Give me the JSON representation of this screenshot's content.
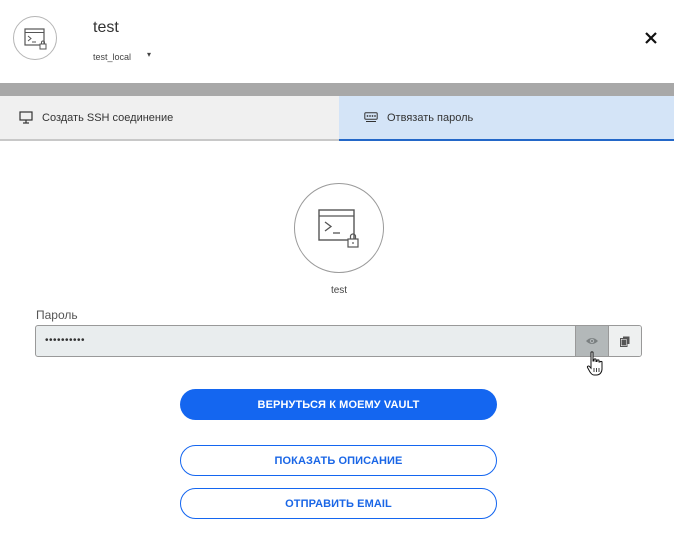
{
  "header": {
    "title": "test",
    "subtitle": "test_local",
    "caret": "▾",
    "close_icon": "close-icon"
  },
  "tabs": [
    {
      "label": "Создать SSH соединение",
      "icon": "monitor-icon",
      "active": false
    },
    {
      "label": "Отвязать пароль",
      "icon": "password-icon",
      "active": true
    }
  ],
  "vault_item": {
    "name": "test",
    "icon": "terminal-lock-icon"
  },
  "password": {
    "label": "Пароль",
    "value": "••••••••••",
    "show_icon": "eye-icon",
    "copy_icon": "copy-icon"
  },
  "buttons": {
    "back_to_vault": "ВЕРНУТЬСЯ К МОЕМУ VAULT",
    "show_description": "ПОКАЗАТЬ ОПИСАНИЕ",
    "send_email": "ОТПРАВИТЬ EMAIL"
  },
  "colors": {
    "accent": "#1466f0",
    "active_tab_bg": "#d4e4f7",
    "active_tab_border": "#2367c8",
    "inactive_tab_bg": "#f0f0f0",
    "band": "#a8a8a8"
  }
}
